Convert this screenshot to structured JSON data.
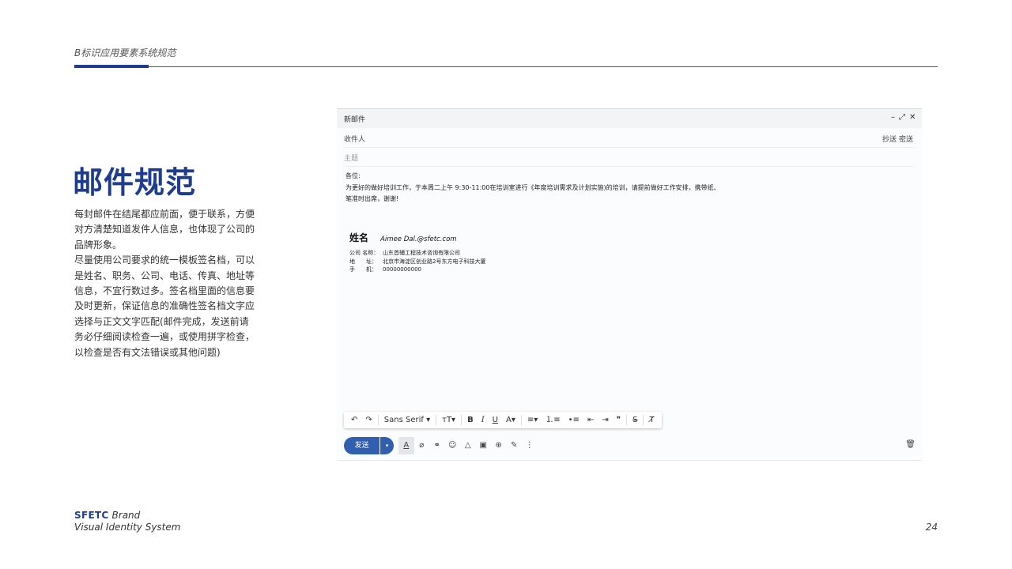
{
  "header": {
    "title": "B标识应用要素系统规范",
    "accent_color": "#1f3d8f"
  },
  "section": {
    "title": "邮件规范",
    "paragraphs": [
      "每封邮件在结尾都应前面，便于联系，方便对方清楚知道发件人信息，也体现了公司的品牌形象。",
      "尽量使用公司要求的统一模板签名档，可以是姓名、职务、公司、电话、传真、地址等信息，不宜行数过多。签名档里面的信息要及时更新，保证信息的准确性签名档文字应选择与正文文字匹配(邮件完成，发送前请务必仔细阅读检查一遍，或使用拼字检查，以检查是否有文法错误或其他问题)"
    ]
  },
  "email": {
    "window_title": "新邮件",
    "controls": {
      "minimize": "minus-icon",
      "expand": "expand-icon",
      "close": "close-icon"
    },
    "recipient_label": "收件人",
    "cc_label": "抄送",
    "bcc_label": "密送",
    "subject_label": "主题",
    "body_lines": [
      "各位:",
      "为更好的做好培训工作，于本周二上午 9:30-11:00在培训室进行《年度培训需求及计划实施)的培训，请提前做好工作安排，携带纸、",
      "笔准时出席，谢谢!"
    ],
    "signature": {
      "name": "姓名",
      "email": "Aimee Dal.@sfetc.com",
      "company_label": "公司 名称：",
      "company": "山东首辅工程技术咨询有限公司",
      "address_label": "地　　址：",
      "address": "北京市海淀区创业路2号东方电子科技大厦",
      "phone_label": "手　　机：",
      "phone": "00000000000"
    },
    "toolbar": {
      "undo": "↶",
      "redo": "↷",
      "font_name": "Sans Serif",
      "font_dropdown": "▾",
      "font_size": "ᴛT▾",
      "bold": "B",
      "italic": "I",
      "underline": "U",
      "text_color": "A▾",
      "align": "≡▾",
      "numbered_list": "⒈≡",
      "bulleted_list": "•≡",
      "indent_less": "⇤",
      "indent_more": "⇥",
      "quote": "❞",
      "strikethrough": "S",
      "clear_format": "T̸"
    },
    "send_label": "发送",
    "send_options": "▾",
    "action_icons": [
      "format-text-icon",
      "attach-icon",
      "link-icon",
      "emoji-icon",
      "drive-icon",
      "photo-icon",
      "lock-icon",
      "pen-icon",
      "more-icon"
    ],
    "accent_color": "#2f5fae"
  },
  "footer": {
    "logo_text": "SFETC",
    "brand": "Brand",
    "tagline": "Visual Identity System",
    "page_number": "24"
  }
}
